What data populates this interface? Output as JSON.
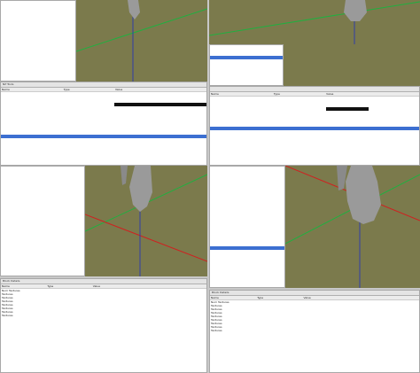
{
  "quad_tl": {
    "tree_rows": [
      "",
      "",
      "",
      "",
      "",
      "",
      "",
      "",
      "",
      ""
    ],
    "status_label": "Nif Tools"
  },
  "quad_tr": {
    "tree_rows": [
      "",
      "",
      "",
      "",
      "",
      "",
      "",
      "",
      "",
      "",
      "",
      "",
      "",
      "",
      "",
      "",
      "",
      "",
      "",
      ""
    ],
    "selected_row": ""
  },
  "quad_ml": {
    "header": {
      "name": "Name",
      "type": "Type",
      "value": "Value"
    },
    "rows": [
      {
        "name": "",
        "type": "",
        "value": ""
      },
      {
        "name": "",
        "type": "",
        "value": ""
      },
      {
        "name": "",
        "type": "",
        "value": ""
      },
      {
        "name": "",
        "type": "",
        "value": ""
      },
      {
        "name": "",
        "type": "",
        "value": ""
      },
      {
        "name": "",
        "type": "",
        "value": ""
      },
      {
        "name": "",
        "type": "",
        "value": ""
      },
      {
        "name": "",
        "type": "",
        "value": ""
      },
      {
        "name": "",
        "type": "",
        "value": ""
      },
      {
        "name": "",
        "type": "",
        "value": ""
      },
      {
        "name": "",
        "type": "",
        "value": ""
      },
      {
        "name": "",
        "type": "",
        "value": ""
      },
      {
        "name": "",
        "type": "",
        "value": ""
      },
      {
        "name": "",
        "type": "",
        "value": ""
      },
      {
        "name": "",
        "type": "",
        "value": ""
      },
      {
        "name": "",
        "type": "",
        "value": ""
      },
      {
        "name": "",
        "type": "",
        "value": ""
      },
      {
        "name": "",
        "type": "",
        "value": ""
      },
      {
        "name": "",
        "type": "",
        "value": ""
      },
      {
        "name": "",
        "type": "",
        "value": ""
      },
      {
        "name": "",
        "type": "",
        "value": ""
      },
      {
        "name": "",
        "type": "",
        "value": ""
      }
    ]
  },
  "quad_bl_bottom": {
    "title": "Block Details",
    "header": {
      "name": "Name",
      "type": "Type",
      "value": "Value"
    },
    "rows": [
      {
        "name": "Num Textures",
        "type": "",
        "value": ""
      },
      {
        "name": "Textures",
        "type": "",
        "value": ""
      },
      {
        "name": "Textures",
        "type": "",
        "value": ""
      },
      {
        "name": "Textures",
        "type": "",
        "value": ""
      },
      {
        "name": "Textures",
        "type": "",
        "value": ""
      },
      {
        "name": "Textures",
        "type": "",
        "value": ""
      },
      {
        "name": "Textures",
        "type": "",
        "value": ""
      },
      {
        "name": "Textures",
        "type": "",
        "value": ""
      }
    ]
  },
  "quad_br_bottom": {
    "title": "Block Details",
    "header": {
      "name": "Name",
      "type": "Type",
      "value": "Value"
    },
    "rows": [
      {
        "name": "Num Textures",
        "type": "",
        "value": ""
      },
      {
        "name": "Textures",
        "type": "",
        "value": ""
      },
      {
        "name": "Textures",
        "type": "",
        "value": ""
      },
      {
        "name": "Textures",
        "type": "",
        "value": ""
      },
      {
        "name": "Textures",
        "type": "",
        "value": ""
      },
      {
        "name": "Textures",
        "type": "",
        "value": ""
      },
      {
        "name": "Textures",
        "type": "",
        "value": ""
      },
      {
        "name": "Textures",
        "type": "",
        "value": ""
      },
      {
        "name": "Textures",
        "type": "",
        "value": ""
      }
    ]
  },
  "colors": {
    "viewport_bg": "#7b7a4c",
    "selection": "#3c6fd1",
    "axis_x": "#d02020",
    "axis_y": "#20b040",
    "axis_z": "#2030c0",
    "model": "#9a9a9a"
  },
  "icons": [
    "tree-node-icon",
    "texture-file-icon"
  ]
}
